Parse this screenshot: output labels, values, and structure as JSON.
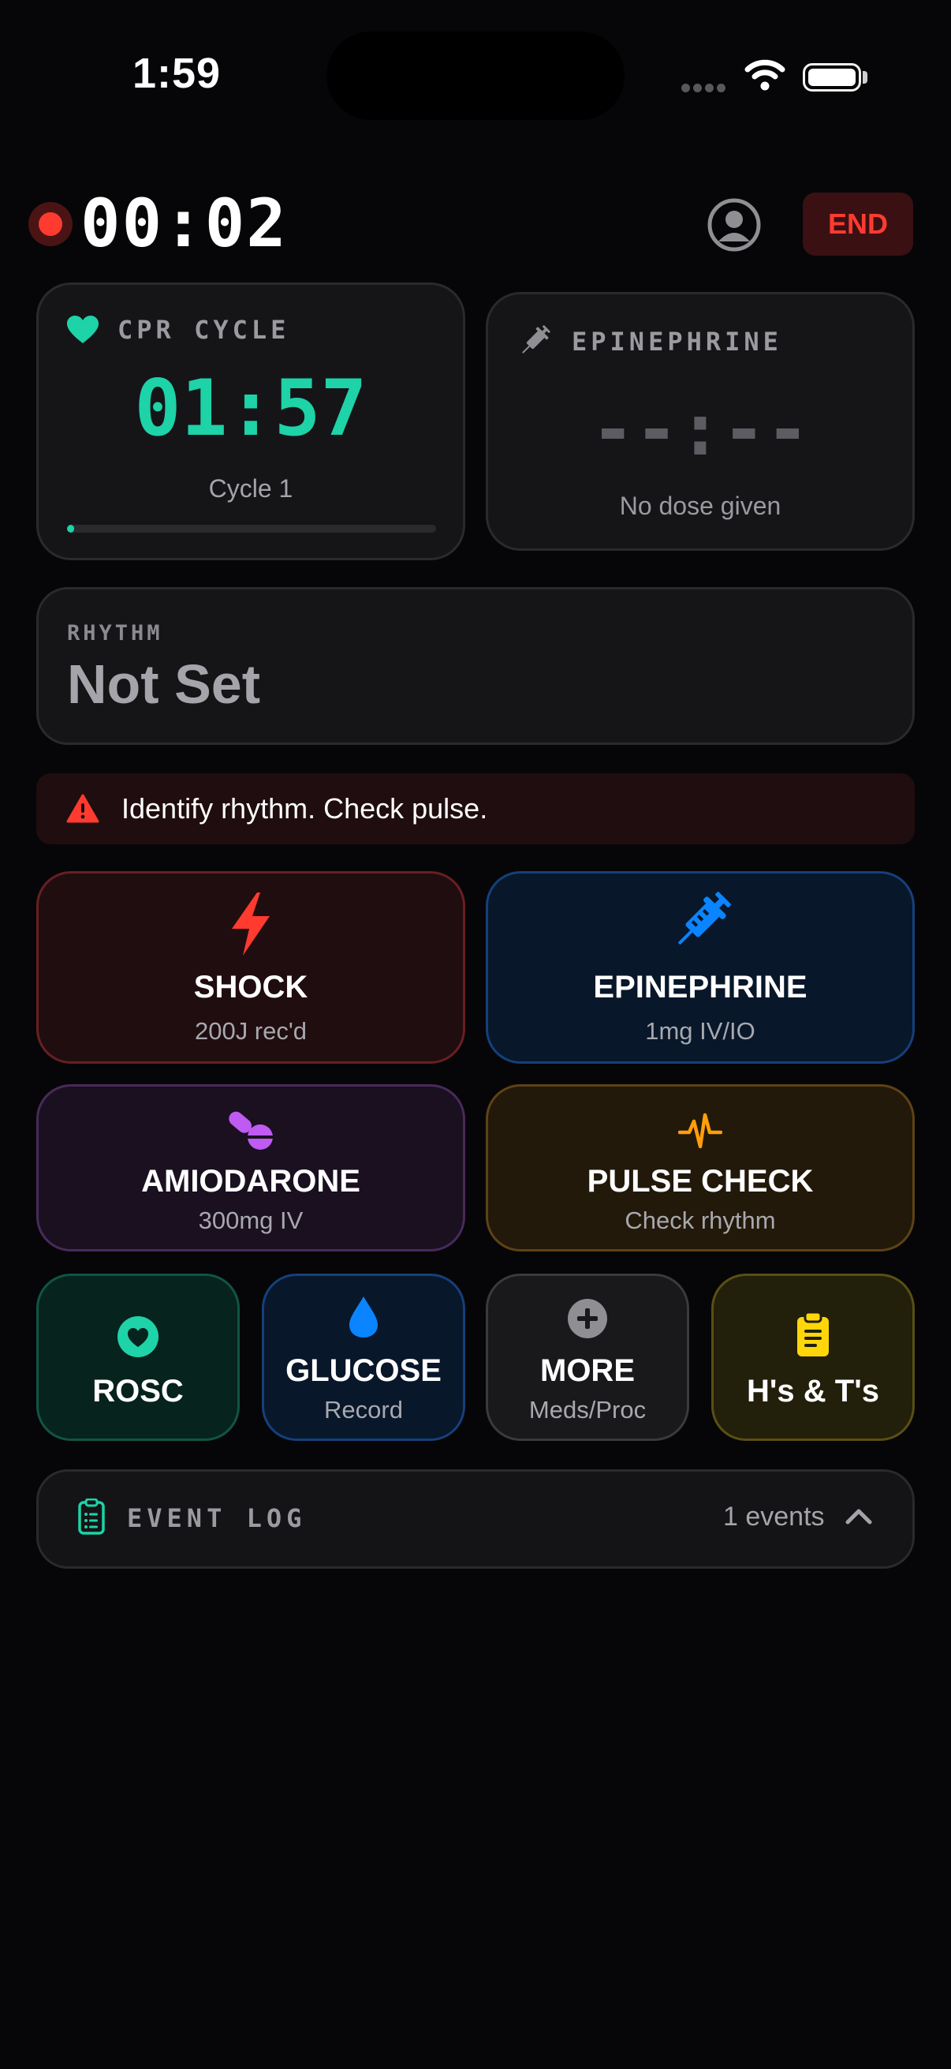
{
  "status_bar": {
    "time": "1:59"
  },
  "header": {
    "elapsed": "00:02",
    "end_label": "END"
  },
  "cpr_card": {
    "title": "CPR CYCLE",
    "timer": "01:57",
    "cycle": "Cycle 1",
    "progress": 0.02,
    "accent": "#1dd3a7"
  },
  "epi_card": {
    "title": "EPINEPHRINE",
    "timer": "--:--",
    "status": "No dose given"
  },
  "rhythm": {
    "label": "RHYTHM",
    "value": "Not Set"
  },
  "alert": {
    "message": "Identify rhythm. Check pulse.",
    "color": "#ff3b30"
  },
  "actions": {
    "shock": {
      "label": "SHOCK",
      "sub": "200J rec'd",
      "icon": "lightning-icon",
      "color": "#ff3b30"
    },
    "epinephrine": {
      "label": "EPINEPHRINE",
      "sub": "1mg IV/IO",
      "icon": "syringe-icon",
      "color": "#0a84ff"
    },
    "amiodarone": {
      "label": "AMIODARONE",
      "sub": "300mg IV",
      "icon": "pills-icon",
      "color": "#bf5af2"
    },
    "pulse_check": {
      "label": "PULSE CHECK",
      "sub": "Check rhythm",
      "icon": "waveform-icon",
      "color": "#ff9f0a"
    },
    "rosc": {
      "label": "ROSC",
      "icon": "heart-circle-icon",
      "color": "#1dd3a7"
    },
    "glucose": {
      "label": "GLUCOSE",
      "sub": "Record",
      "icon": "drop-icon",
      "color": "#0a84ff"
    },
    "more": {
      "label": "MORE",
      "sub": "Meds/Proc",
      "icon": "plus-circle-icon",
      "color": "#8e8e93"
    },
    "hs_ts": {
      "label": "H's & T's",
      "icon": "clipboard-icon",
      "color": "#ffd60a"
    }
  },
  "event_log": {
    "title": "EVENT LOG",
    "count": "1 events"
  }
}
